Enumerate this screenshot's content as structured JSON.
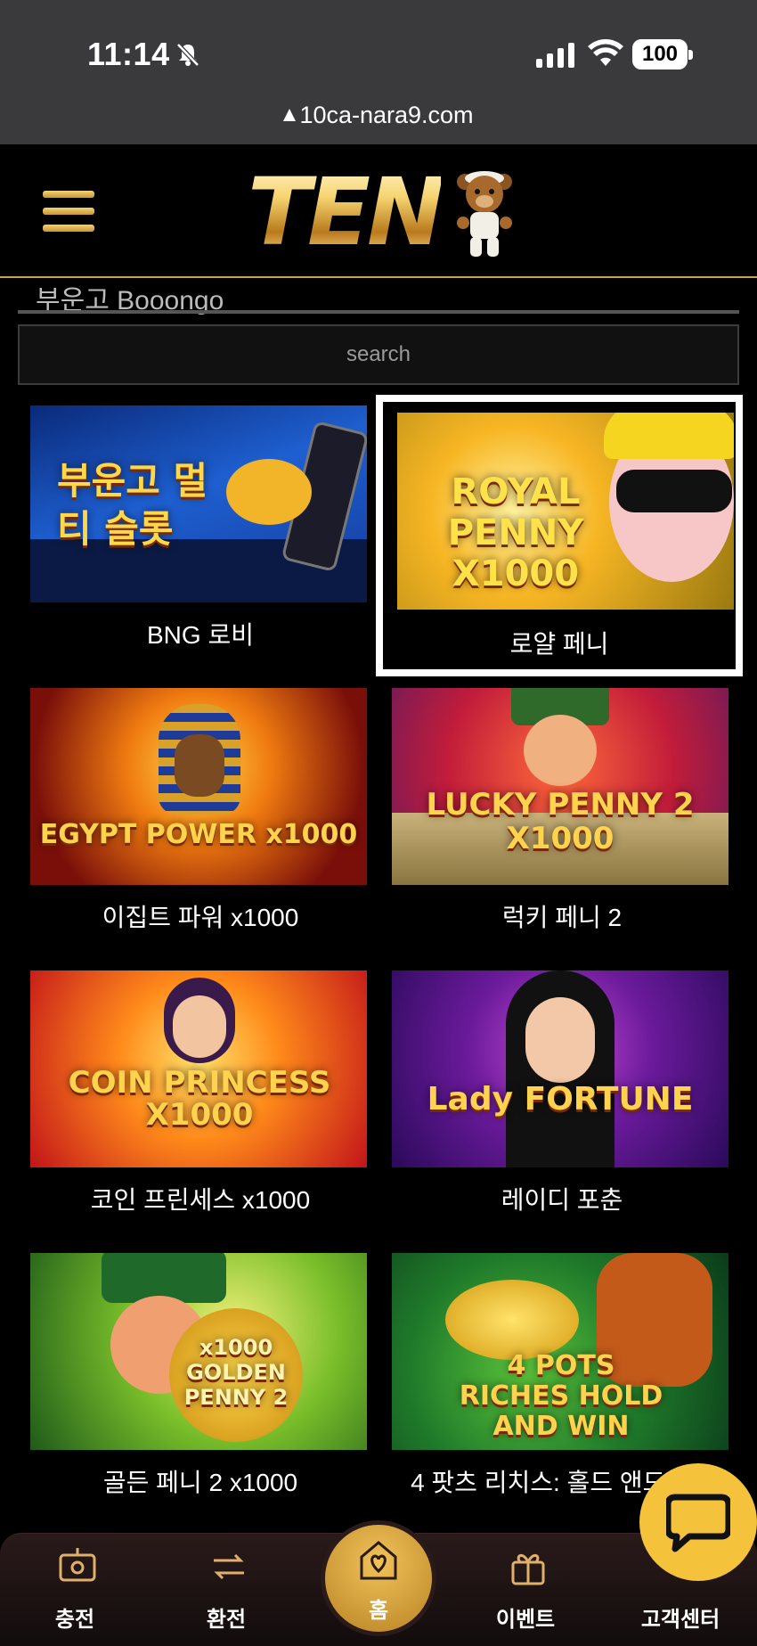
{
  "status_bar": {
    "time": "11:14",
    "battery": "100"
  },
  "browser": {
    "url": "10ca-nara9.com"
  },
  "header": {
    "logo_text": "TEN",
    "section_title_partial": "부운고   Booongo"
  },
  "search": {
    "placeholder": "search"
  },
  "games": [
    {
      "label": "BNG 로비",
      "thumb_text": "부운고 멀티 슬롯",
      "selected": false
    },
    {
      "label": "로얄 페니",
      "thumb_text": "ROYAL PENNY X1000",
      "selected": true
    },
    {
      "label": "이집트 파워 x1000",
      "thumb_text": "EGYPT POWER x1000",
      "selected": false
    },
    {
      "label": "럭키 페니 2",
      "thumb_text": "LUCKY PENNY 2 X1000",
      "selected": false
    },
    {
      "label": "코인 프린세스 x1000",
      "thumb_text": "COIN PRINCESS X1000",
      "selected": false
    },
    {
      "label": "레이디 포춘",
      "thumb_text": "Lady FORTUNE",
      "selected": false
    },
    {
      "label": "골든 페니 2 x1000",
      "thumb_text": "x1000 GOLDEN PENNY 2",
      "selected": false
    },
    {
      "label": "4 팟츠 리치스: 홀드 앤드 윈",
      "thumb_text": "4 POTS RICHES HOLD AND WIN",
      "selected": false
    }
  ],
  "bottom_nav": {
    "deposit": "충전",
    "exchange": "환전",
    "home": "홈",
    "event": "이벤트",
    "support": "고객센터"
  },
  "colors": {
    "gold": "#f4c23b",
    "nav_bg": "#1e1414"
  }
}
